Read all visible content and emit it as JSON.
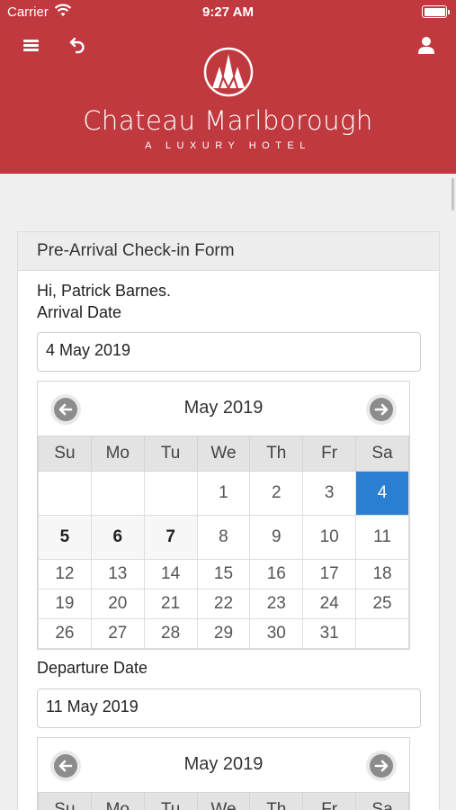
{
  "status": {
    "carrier": "Carrier",
    "time": "9:27 AM"
  },
  "brand": {
    "name": "Chateau Marlborough",
    "tagline": "A LUXURY HOTEL"
  },
  "form": {
    "title": "Pre-Arrival Check-in Form",
    "greeting": "Hi, Patrick Barnes.",
    "arrival_label": "Arrival Date",
    "arrival_value": "4 May 2019",
    "departure_label": "Departure Date",
    "departure_value": "11 May 2019"
  },
  "calendar1": {
    "title": "May 2019",
    "weekdays": [
      "Su",
      "Mo",
      "Tu",
      "We",
      "Th",
      "Fr",
      "Sa"
    ],
    "weeks": [
      [
        "",
        "",
        "",
        "1",
        "2",
        "3",
        "4"
      ],
      [
        "5",
        "6",
        "7",
        "8",
        "9",
        "10",
        "11"
      ],
      [
        "12",
        "13",
        "14",
        "15",
        "16",
        "17",
        "18"
      ],
      [
        "19",
        "20",
        "21",
        "22",
        "23",
        "24",
        "25"
      ],
      [
        "26",
        "27",
        "28",
        "29",
        "30",
        "31",
        ""
      ]
    ],
    "selected": "4",
    "bold_days": [
      "5",
      "6",
      "7"
    ]
  },
  "calendar2": {
    "title": "May 2019",
    "weekdays": [
      "Su",
      "Mo",
      "Tu",
      "We",
      "Th",
      "Fr",
      "Sa"
    ]
  },
  "colors": {
    "brand": "#c0393e",
    "selected": "#2a7fd2"
  }
}
